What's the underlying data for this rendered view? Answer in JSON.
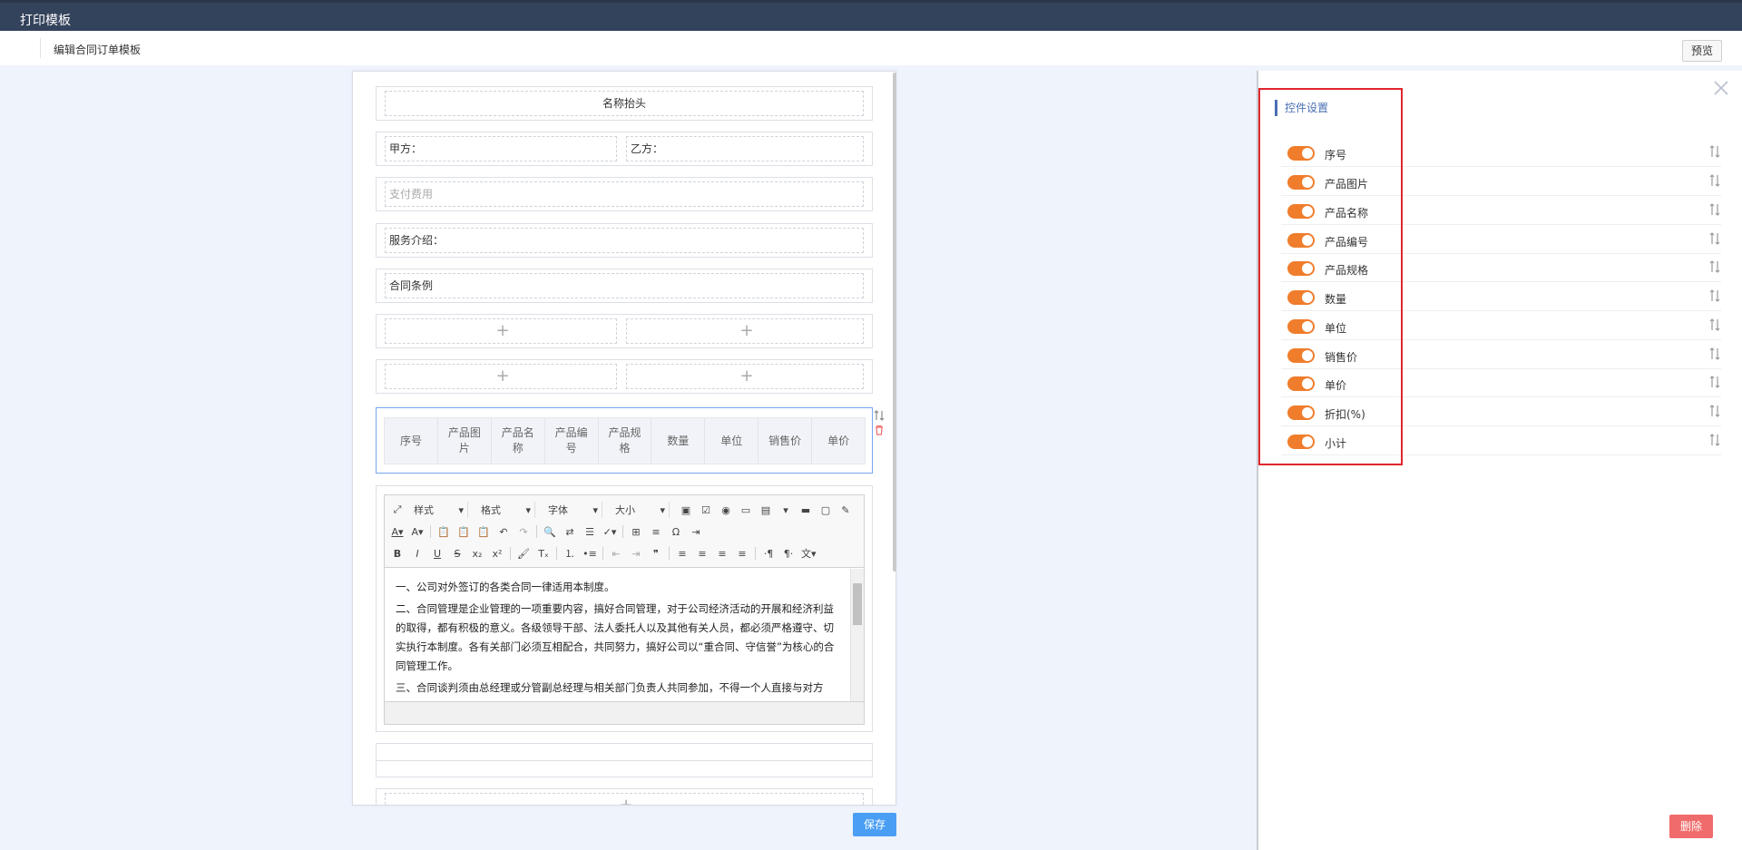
{
  "header": {
    "title": "打印模板"
  },
  "subheader": {
    "title": "编辑合同订单模板",
    "preview_label": "预览"
  },
  "template": {
    "title_field": "名称抬头",
    "party_a": "甲方：",
    "party_b": "乙方：",
    "payment_placeholder": "支付费用",
    "service_intro": "服务介绍：",
    "contract_terms": "合同条例",
    "plus": "+",
    "table_columns": [
      "序号",
      "产品图\n片",
      "产品名\n称",
      "产品编\n号",
      "产品规\n格",
      "数量",
      "单位",
      "销售价",
      "单价"
    ],
    "editor": {
      "combos": [
        "样式",
        "格式",
        "字体",
        "大小"
      ],
      "paragraphs": [
        "一、公司对外签订的各类合同一律适用本制度。",
        "二、合同管理是企业管理的一项重要内容，搞好合同管理，对于公司经济活动的开展和经济利益的取得，都有积极的意义。各级领导干部、法人委托人以及其他有关人员，都必须严格遵守、切实执行本制度。各有关部门必须互相配合，共同努力，搞好公司以“重合同、守信誉”为核心的合同管理工作。",
        "三、合同谈判须由总经理或分管副总经理与相关部门负责人共同参加，不得一个人直接与对方"
      ]
    },
    "save_label": "保存"
  },
  "settings": {
    "title": "控件设置",
    "items": [
      {
        "label": "序号",
        "enabled": true
      },
      {
        "label": "产品图片",
        "enabled": true
      },
      {
        "label": "产品名称",
        "enabled": true
      },
      {
        "label": "产品编号",
        "enabled": true
      },
      {
        "label": "产品规格",
        "enabled": true
      },
      {
        "label": "数量",
        "enabled": true
      },
      {
        "label": "单位",
        "enabled": true
      },
      {
        "label": "销售价",
        "enabled": true
      },
      {
        "label": "单价",
        "enabled": true
      },
      {
        "label": "折扣(%)",
        "enabled": true
      },
      {
        "label": "小计",
        "enabled": true
      }
    ],
    "delete_label": "删除"
  },
  "colors": {
    "header_bg": "#34435c",
    "toggle_on": "#f07d2c",
    "primary": "#4a9ff5",
    "danger": "#f06b6b",
    "highlight": "#e0272d"
  }
}
